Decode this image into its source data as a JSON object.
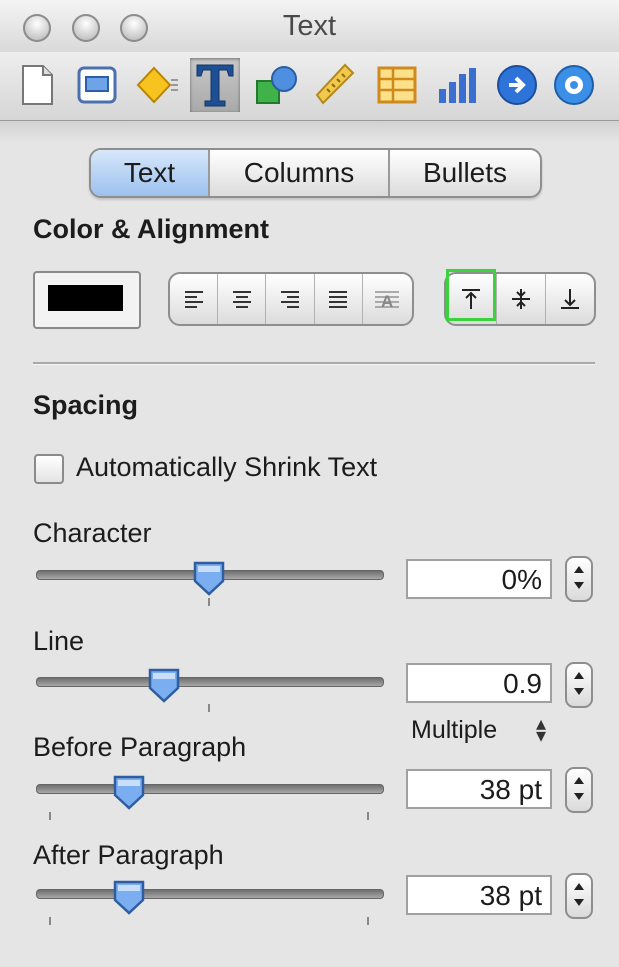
{
  "window": {
    "title": "Text"
  },
  "toolbar": {
    "items": [
      {
        "name": "document-icon"
      },
      {
        "name": "layout-icon"
      },
      {
        "name": "graphic-icon"
      },
      {
        "name": "text-icon",
        "active": true
      },
      {
        "name": "shapes-icon"
      },
      {
        "name": "metrics-icon"
      },
      {
        "name": "table-icon"
      },
      {
        "name": "chart-icon"
      },
      {
        "name": "link-icon"
      },
      {
        "name": "quicktime-icon"
      }
    ]
  },
  "tabs": {
    "text": "Text",
    "columns": "Columns",
    "bullets": "Bullets",
    "selected": "Text"
  },
  "color_alignment": {
    "heading": "Color & Alignment",
    "color": "#000000",
    "horizontal": [
      "align-left-icon",
      "align-center-icon",
      "align-right-icon",
      "justify-icon",
      "auto-align-icon"
    ],
    "vertical": [
      "align-top-icon",
      "align-middle-icon",
      "align-bottom-icon"
    ],
    "vertical_selected": "align-top-icon",
    "highlight_color": "#3cd23c"
  },
  "spacing": {
    "heading": "Spacing",
    "auto_shrink": {
      "label": "Automatically Shrink Text",
      "checked": false
    },
    "character": {
      "label": "Character",
      "value": "0%",
      "slider": 0.5
    },
    "line": {
      "label": "Line",
      "value": "0.9",
      "slider": 0.37,
      "mode": "Multiple"
    },
    "before_paragraph": {
      "label": "Before Paragraph",
      "value": "38 pt",
      "slider": 0.27
    },
    "after_paragraph": {
      "label": "After Paragraph",
      "value": "38 pt",
      "slider": 0.27
    }
  }
}
